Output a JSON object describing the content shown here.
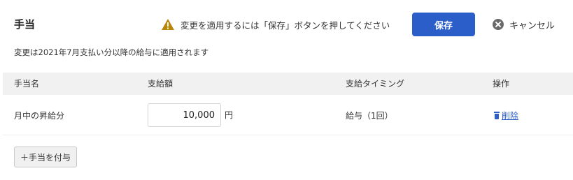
{
  "header": {
    "title": "手当",
    "warning_text": "変更を適用するには「保存」ボタンを押してください",
    "save_label": "保存",
    "cancel_label": "キャンセル"
  },
  "notice": "変更は2021年7月支払い分以降の給与に適用されます",
  "table": {
    "columns": [
      "手当名",
      "支給額",
      "支給タイミング",
      "操作"
    ],
    "rows": [
      {
        "name": "月中の昇給分",
        "amount": "10,000",
        "unit": "円",
        "timing": "給与（1回）",
        "action_label": "削除"
      }
    ]
  },
  "add_button_label": "＋手当を付与",
  "colors": {
    "primary": "#2b5ec9",
    "warning": "#b8860b",
    "header_bg": "#f1f1f1"
  },
  "icons": [
    "warning-icon",
    "close-circle-icon",
    "trash-icon"
  ]
}
